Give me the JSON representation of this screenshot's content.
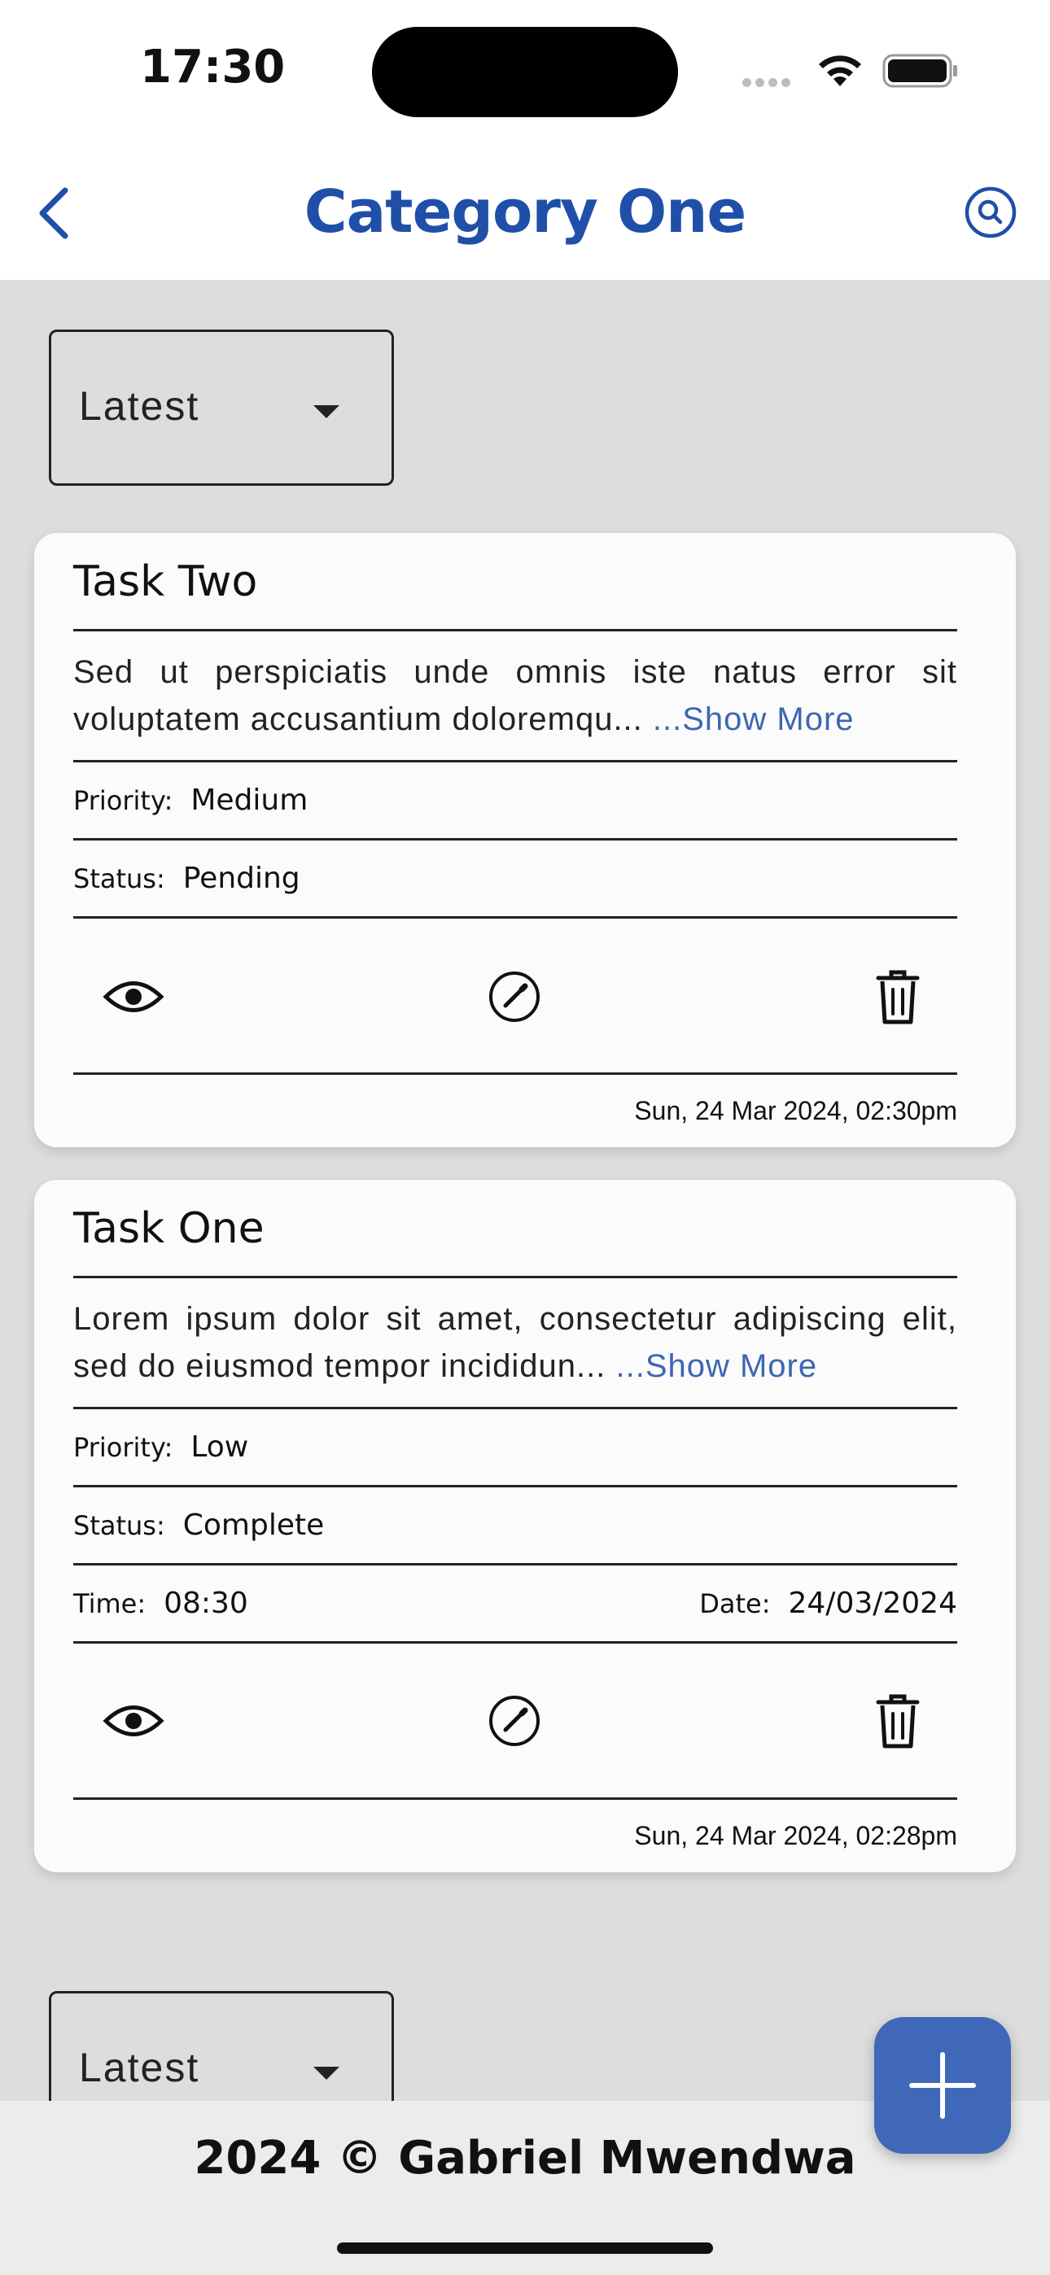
{
  "status_bar": {
    "time": "17:30"
  },
  "header": {
    "title": "Category One",
    "back_icon": "chevron-left-icon",
    "search_icon": "search-icon"
  },
  "sort": {
    "selected": "Latest"
  },
  "tasks": [
    {
      "title": "Task Two",
      "description": "Sed ut perspiciatis unde omnis iste natus error sit voluptatem accusantium doloremqu...",
      "show_more": " ...Show More",
      "priority_label": "Priority:",
      "priority": "Medium",
      "status_label": "Status:",
      "status": "Pending",
      "timestamp": "Sun, 24 Mar 2024, 02:30pm"
    },
    {
      "title": "Task One",
      "description": "Lorem ipsum dolor sit amet, consectetur adipiscing elit, sed do eiusmod tempor incididun...",
      "show_more": " ...Show More",
      "priority_label": "Priority:",
      "priority": "Low",
      "status_label": "Status:",
      "status": "Complete",
      "time_label": "Time:",
      "time": "08:30",
      "date_label": "Date:",
      "date": "24/03/2024",
      "timestamp": "Sun, 24 Mar 2024, 02:28pm"
    }
  ],
  "bottom_sort": {
    "selected": "Latest"
  },
  "footer": {
    "text": "2024 © Gabriel Mwendwa"
  },
  "colors": {
    "accent": "#1f4fa8",
    "fab": "#3f68b8",
    "link": "#3d66b3",
    "background": "#dddddd"
  }
}
